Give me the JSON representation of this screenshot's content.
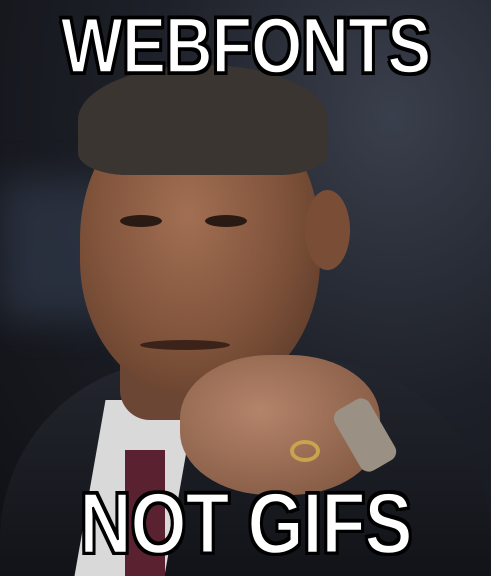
{
  "meme": {
    "top_text": "WEBFONTS",
    "bottom_text": "NOT GIFS"
  }
}
